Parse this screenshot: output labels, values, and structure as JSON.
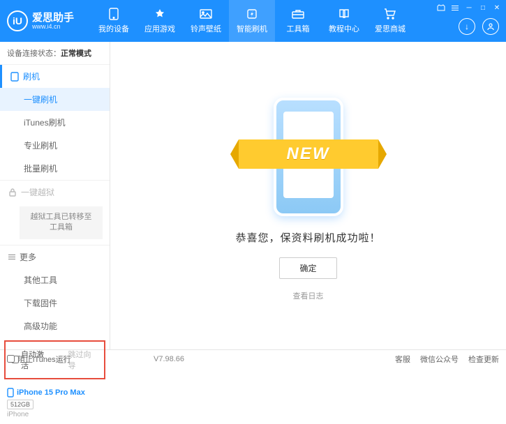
{
  "app": {
    "title": "爱思助手",
    "url": "www.i4.cn",
    "logo_letter": "iU"
  },
  "nav": [
    {
      "label": "我的设备"
    },
    {
      "label": "应用游戏"
    },
    {
      "label": "铃声壁纸"
    },
    {
      "label": "智能刷机"
    },
    {
      "label": "工具箱"
    },
    {
      "label": "教程中心"
    },
    {
      "label": "爱思商城"
    }
  ],
  "status": {
    "label": "设备连接状态：",
    "value": "正常模式"
  },
  "side": {
    "flash": {
      "title": "刷机",
      "items": [
        "一键刷机",
        "iTunes刷机",
        "专业刷机",
        "批量刷机"
      ]
    },
    "jailbreak": {
      "title": "一键越狱",
      "note": "越狱工具已转移至\n工具箱"
    },
    "more": {
      "title": "更多",
      "items": [
        "其他工具",
        "下载固件",
        "高级功能"
      ]
    }
  },
  "checkboxes": {
    "auto_activate": "自动激活",
    "skip_guide": "跳过向导"
  },
  "device": {
    "name": "iPhone 15 Pro Max",
    "storage": "512GB",
    "type": "iPhone"
  },
  "main": {
    "banner": "NEW",
    "success": "恭喜您，保资料刷机成功啦！",
    "ok": "确定",
    "view_log": "查看日志"
  },
  "footer": {
    "block_itunes": "阻止iTunes运行",
    "version": "V7.98.66",
    "links": [
      "客服",
      "微信公众号",
      "检查更新"
    ]
  }
}
